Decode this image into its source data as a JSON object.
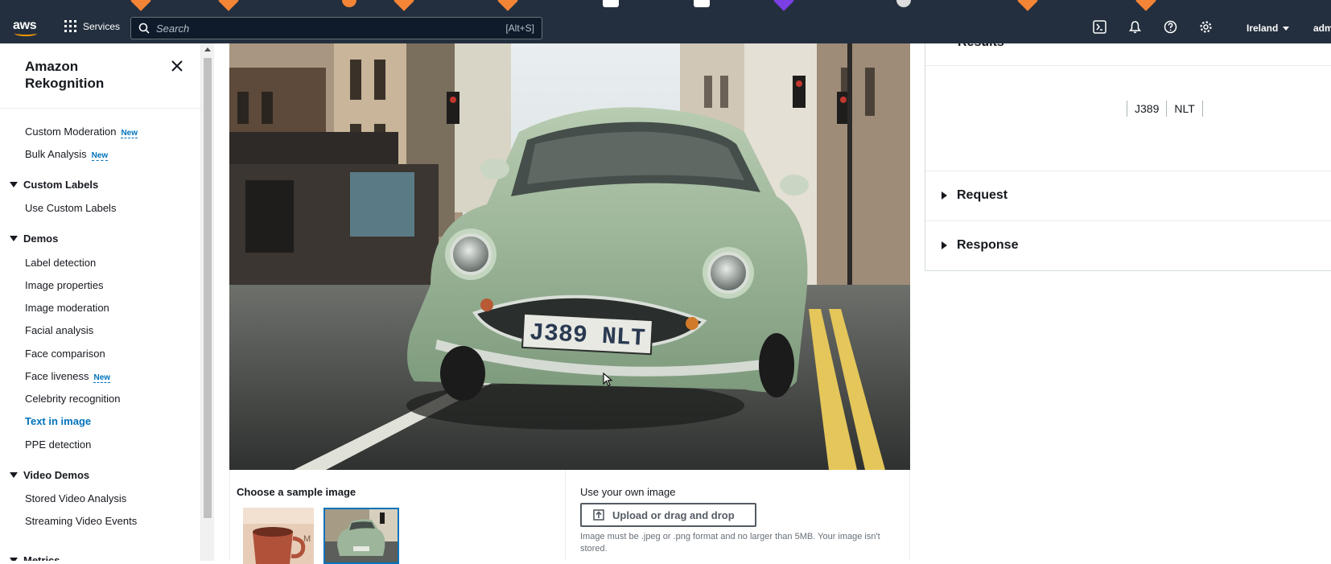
{
  "header": {
    "services_label": "Services",
    "search_placeholder": "Search",
    "search_shortcut": "[Alt+S]",
    "region": "Ireland",
    "account": "adm"
  },
  "sidebar": {
    "title": "Amazon Rekognition",
    "new_badge": "New",
    "items_top": [
      {
        "label": "Custom Moderation",
        "badge": "New"
      },
      {
        "label": "Bulk Analysis",
        "badge": "New"
      }
    ],
    "sections": [
      {
        "title": "Custom Labels",
        "items": [
          {
            "label": "Use Custom Labels"
          }
        ]
      },
      {
        "title": "Demos",
        "items": [
          {
            "label": "Label detection"
          },
          {
            "label": "Image properties"
          },
          {
            "label": "Image moderation"
          },
          {
            "label": "Facial analysis"
          },
          {
            "label": "Face comparison"
          },
          {
            "label": "Face liveness",
            "badge": "New"
          },
          {
            "label": "Celebrity recognition"
          },
          {
            "label": "Text in image",
            "active": true
          },
          {
            "label": "PPE detection"
          }
        ]
      },
      {
        "title": "Video Demos",
        "items": [
          {
            "label": "Stored Video Analysis"
          },
          {
            "label": "Streaming Video Events"
          }
        ]
      },
      {
        "title": "Metrics",
        "items": []
      }
    ]
  },
  "main": {
    "sample_label": "Choose a sample image",
    "own_image_label": "Use your own image",
    "upload_button": "Upload or drag and drop",
    "upload_note": "Image must be .jpeg or .png format and no larger than 5MB. Your image isn't stored.",
    "plate_text": "J389 NLT"
  },
  "results": {
    "title": "Results",
    "words": [
      "J389",
      "NLT"
    ],
    "request_label": "Request",
    "response_label": "Response"
  },
  "colors": {
    "header_bg": "#232f3e",
    "link_active": "#0073bb",
    "car_green": "#9db59a"
  }
}
